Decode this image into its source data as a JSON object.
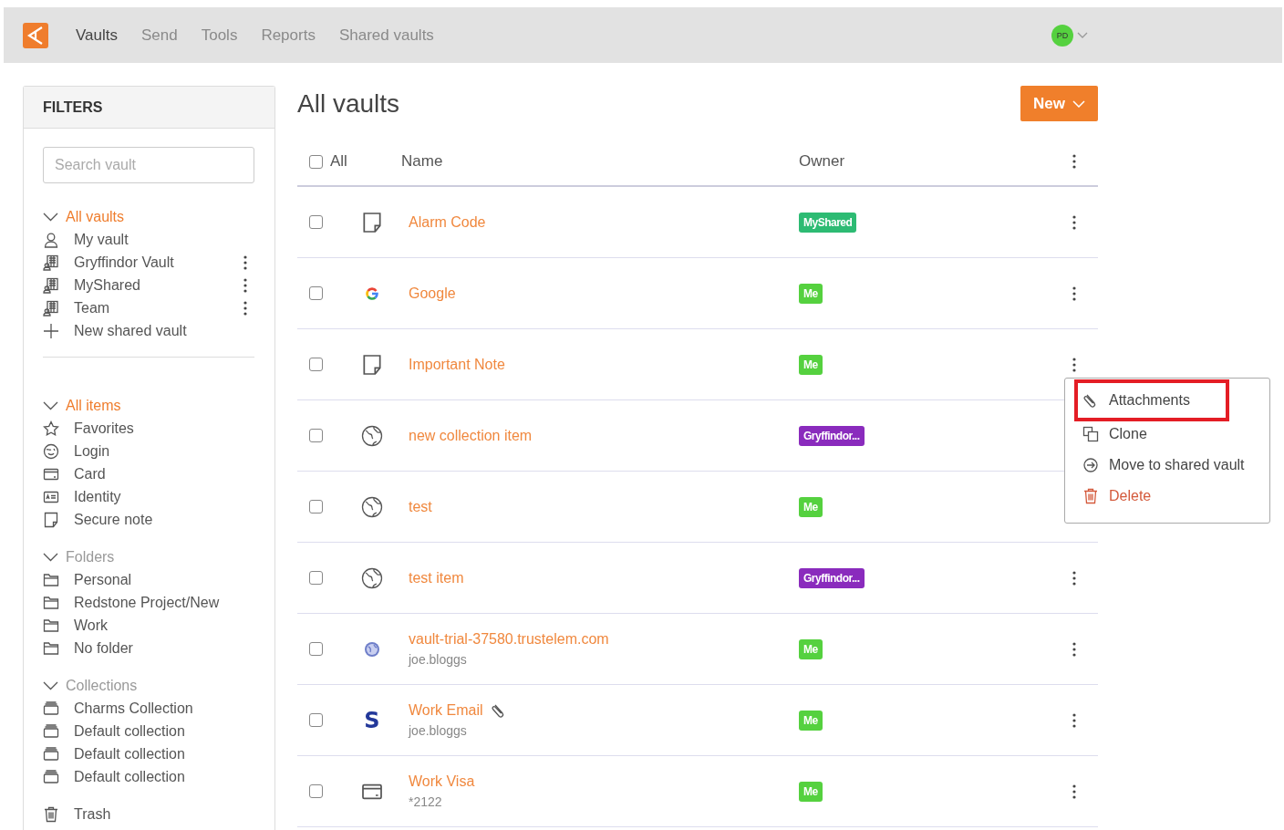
{
  "topbar": {
    "nav": [
      {
        "label": "Vaults",
        "selected": true
      },
      {
        "label": "Send",
        "selected": false
      },
      {
        "label": "Tools",
        "selected": false
      },
      {
        "label": "Reports",
        "selected": false
      },
      {
        "label": "Shared vaults",
        "selected": false
      }
    ],
    "avatar": {
      "initials": "PD",
      "color": "#55d13f"
    }
  },
  "sidebar": {
    "title": "FILTERS",
    "search": {
      "placeholder": "Search vault"
    },
    "sections": [
      {
        "label": "All vaults",
        "selected": true,
        "items": [
          {
            "label": "My vault",
            "kind": "person",
            "has_menu": false
          },
          {
            "label": "Gryffindor Vault",
            "kind": "shared",
            "has_menu": true
          },
          {
            "label": "MyShared",
            "kind": "shared",
            "has_menu": true
          },
          {
            "label": "Team",
            "kind": "shared",
            "has_menu": true
          },
          {
            "label": "New shared vault",
            "kind": "plus",
            "has_menu": false
          }
        ]
      },
      {
        "label": "All items",
        "selected": true,
        "items": [
          {
            "label": "Favorites",
            "kind": "star",
            "has_menu": false
          },
          {
            "label": "Login",
            "kind": "login",
            "has_menu": false
          },
          {
            "label": "Card",
            "kind": "card",
            "has_menu": false
          },
          {
            "label": "Identity",
            "kind": "identity",
            "has_menu": false
          },
          {
            "label": "Secure note",
            "kind": "note",
            "has_menu": false
          }
        ]
      },
      {
        "label": "Folders",
        "selected": false,
        "items": [
          {
            "label": "Personal",
            "kind": "folder",
            "has_menu": false
          },
          {
            "label": "Redstone Project/New",
            "kind": "folder",
            "has_menu": false
          },
          {
            "label": "Work",
            "kind": "folder",
            "has_menu": false
          },
          {
            "label": "No folder",
            "kind": "folder",
            "has_menu": false
          }
        ]
      },
      {
        "label": "Collections",
        "selected": false,
        "items": [
          {
            "label": "Charms Collection",
            "kind": "collection",
            "has_menu": false
          },
          {
            "label": "Default collection",
            "kind": "collection",
            "has_menu": false
          },
          {
            "label": "Default collection",
            "kind": "collection",
            "has_menu": false
          },
          {
            "label": "Default collection",
            "kind": "collection",
            "has_menu": false
          }
        ]
      }
    ],
    "trash": {
      "label": "Trash"
    }
  },
  "main": {
    "title": "All vaults",
    "new_button": "New",
    "table": {
      "columns": [
        "All",
        "Name",
        "Owner"
      ],
      "all_checked": false,
      "rows": [
        {
          "name": "Alarm Code",
          "kind": "note",
          "owner": {
            "label": "MyShared",
            "color": "#2dbb73"
          },
          "checked": false,
          "attachment": false
        },
        {
          "name": "Google",
          "kind": "google",
          "owner": {
            "label": "Me",
            "color": "#55d13f"
          },
          "checked": false,
          "attachment": false
        },
        {
          "name": "Important Note",
          "kind": "note",
          "owner": {
            "label": "Me",
            "color": "#55d13f"
          },
          "checked": false,
          "attachment": false,
          "context_menu": [
            {
              "label": "Attachments",
              "kind": "attachments",
              "highlighted": true
            },
            {
              "label": "Clone",
              "kind": "clone",
              "highlighted": false
            },
            {
              "label": "Move to shared vault",
              "kind": "move",
              "highlighted": false
            },
            {
              "label": "Delete",
              "kind": "delete",
              "highlighted": false
            }
          ]
        },
        {
          "name": "new collection item",
          "kind": "globe",
          "owner": {
            "label": "Gryffindor...",
            "color": "#8a2bbd"
          },
          "checked": false,
          "attachment": false
        },
        {
          "name": "test",
          "kind": "globe",
          "owner": {
            "label": "Me",
            "color": "#55d13f"
          },
          "checked": false,
          "attachment": false
        },
        {
          "name": "test item",
          "kind": "globe",
          "owner": {
            "label": "Gryffindor...",
            "color": "#8a2bbd"
          },
          "checked": false,
          "attachment": false
        },
        {
          "name": "vault-trial-37580.trustelem.com",
          "subtitle": "joe.bloggs",
          "kind": "web",
          "owner": {
            "label": "Me",
            "color": "#55d13f"
          },
          "checked": false,
          "attachment": false
        },
        {
          "name": "Work Email",
          "subtitle": "joe.bloggs",
          "kind": "letter",
          "icon_text": "S",
          "owner": {
            "label": "Me",
            "color": "#55d13f"
          },
          "checked": false,
          "attachment": true
        },
        {
          "name": "Work Visa",
          "subtitle": "*2122",
          "kind": "card",
          "owner": {
            "label": "Me",
            "color": "#55d13f"
          },
          "checked": false,
          "attachment": false
        }
      ]
    }
  }
}
